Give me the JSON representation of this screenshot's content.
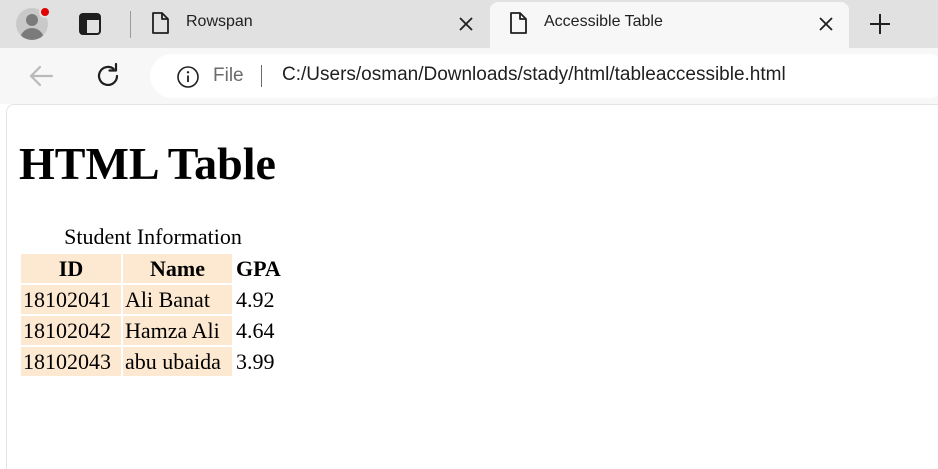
{
  "tabs": [
    {
      "title": "Rowspan",
      "active": false
    },
    {
      "title": "Accessible Table",
      "active": true
    }
  ],
  "toolbar": {
    "scheme_label": "File",
    "url": "C:/Users/osman/Downloads/stady/html/tableaccessible.html"
  },
  "page": {
    "heading": "HTML Table",
    "table": {
      "caption": "Student Information",
      "headers": [
        "ID",
        "Name",
        "GPA"
      ],
      "rows": [
        [
          "18102041",
          "Ali Banat",
          "4.92"
        ],
        [
          "18102042",
          "Hamza Ali",
          "4.64"
        ],
        [
          "18102043",
          "abu ubaida",
          "3.99"
        ]
      ],
      "shade_color": "#fde9d2"
    }
  },
  "icons": {
    "profile": "profile-avatar-icon",
    "tab_actions": "tab-actions-icon",
    "document": "document-icon",
    "close": "close-icon",
    "new_tab": "plus-icon",
    "back": "arrow-left-icon",
    "reload": "reload-icon",
    "info": "info-icon"
  }
}
